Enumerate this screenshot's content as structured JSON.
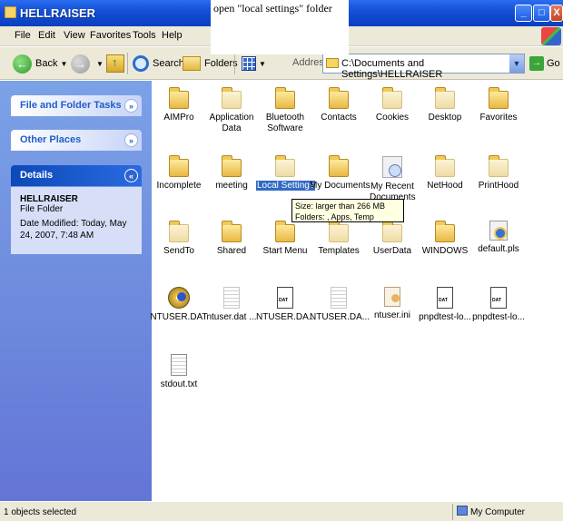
{
  "window": {
    "title": "HELLRAISER"
  },
  "annotation": "open \"local settings\" folder",
  "menu": [
    "File",
    "Edit",
    "View",
    "Favorites",
    "Tools",
    "Help"
  ],
  "toolbar": {
    "back": "Back",
    "search": "Search",
    "folders": "Folders",
    "address_label": "Address",
    "address_value": "C:\\Documents and Settings\\HELLRAISER",
    "go": "Go"
  },
  "left_pane": {
    "file_folder_tasks": "File and Folder Tasks",
    "other_places": "Other Places",
    "details": "Details",
    "details_name": "HELLRAISER",
    "details_type": "File Folder",
    "details_modified": "Date Modified: Today, May 24, 2007, 7:48 AM"
  },
  "items": [
    {
      "label": "AIMPro",
      "icon": "folder-icon"
    },
    {
      "label": "Application Data",
      "icon": "folder-icon"
    },
    {
      "label": "Bluetooth Software",
      "icon": "folder-icon"
    },
    {
      "label": "Contacts",
      "icon": "folder-icon"
    },
    {
      "label": "Cookies",
      "icon": "folder-icon"
    },
    {
      "label": "Desktop",
      "icon": "folder-icon"
    },
    {
      "label": "Favorites",
      "icon": "folder-icon"
    },
    {
      "label": "Incomplete",
      "icon": "folder-icon"
    },
    {
      "label": "meeting",
      "icon": "folder-icon"
    },
    {
      "label": "Local Settings",
      "icon": "folder-icon"
    },
    {
      "label": "My Documents",
      "icon": "folder-icon"
    },
    {
      "label": "My Recent Documents",
      "icon": "recent-documents-icon"
    },
    {
      "label": "NetHood",
      "icon": "folder-icon"
    },
    {
      "label": "PrintHood",
      "icon": "folder-icon"
    },
    {
      "label": "SendTo",
      "icon": "folder-icon"
    },
    {
      "label": "Shared",
      "icon": "folder-icon"
    },
    {
      "label": "Start Menu",
      "icon": "folder-icon"
    },
    {
      "label": "Templates",
      "icon": "folder-icon"
    },
    {
      "label": "UserData",
      "icon": "folder-icon"
    },
    {
      "label": "WINDOWS",
      "icon": "folder-icon"
    },
    {
      "label": "default.pls",
      "icon": "playlist-file-icon"
    },
    {
      "label": "NTUSER.DAT",
      "icon": "disc-file-icon"
    },
    {
      "label": "ntuser.dat ...",
      "icon": "text-file-icon"
    },
    {
      "label": "NTUSER.DA...",
      "icon": "dat-file-icon"
    },
    {
      "label": "NTUSER.DA...",
      "icon": "text-file-icon"
    },
    {
      "label": "ntuser.ini",
      "icon": "ini-file-icon"
    },
    {
      "label": "pnpdtest-lo...",
      "icon": "dat-file-icon"
    },
    {
      "label": "pnpdtest-lo...",
      "icon": "dat-file-icon"
    },
    {
      "label": "stdout.txt",
      "icon": "text-file-icon"
    }
  ],
  "tooltip": {
    "line1": "Size: larger than 266 MB",
    "line2": "Folders: , Apps, Temp"
  },
  "status": {
    "left": "1 objects selected",
    "right": "My Computer"
  }
}
